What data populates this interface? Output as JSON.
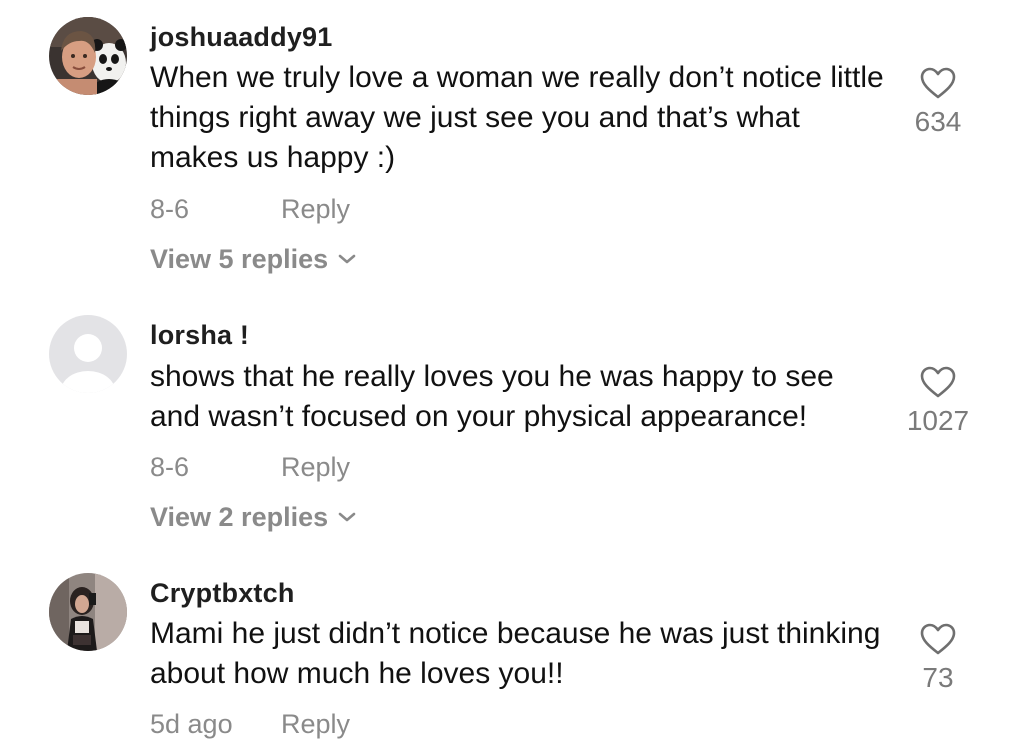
{
  "comments": [
    {
      "username": "joshuaaddy91",
      "text": "When we truly love a woman we really don’t notice little things right away we just see you and that’s what makes us happy :)",
      "date": "8-6",
      "reply_label": "Reply",
      "replies_label": "View 5 replies",
      "likes": "634",
      "avatar_icon": "user-photo-panda"
    },
    {
      "username": "lorsha !",
      "text": "shows that he really loves you he was happy to see and wasn’t focused on your physical appearance!",
      "date": "8-6",
      "reply_label": "Reply",
      "replies_label": "View 2 replies",
      "likes": "1027",
      "avatar_icon": "default-avatar"
    },
    {
      "username": "Cryptbxtch",
      "text": "Mami he just didn’t notice because he was just thinking about how much he loves you!!",
      "date": "5d ago",
      "reply_label": "Reply",
      "likes": "73",
      "avatar_icon": "user-photo-mirror-selfie"
    }
  ],
  "icons": {
    "like": "heart-outline-icon",
    "expand": "chevron-down-icon"
  },
  "colors": {
    "text": "#111111",
    "muted": "#8a8a8a",
    "count": "#7a7a7a",
    "default_avatar_bg": "#e3e3e6"
  }
}
